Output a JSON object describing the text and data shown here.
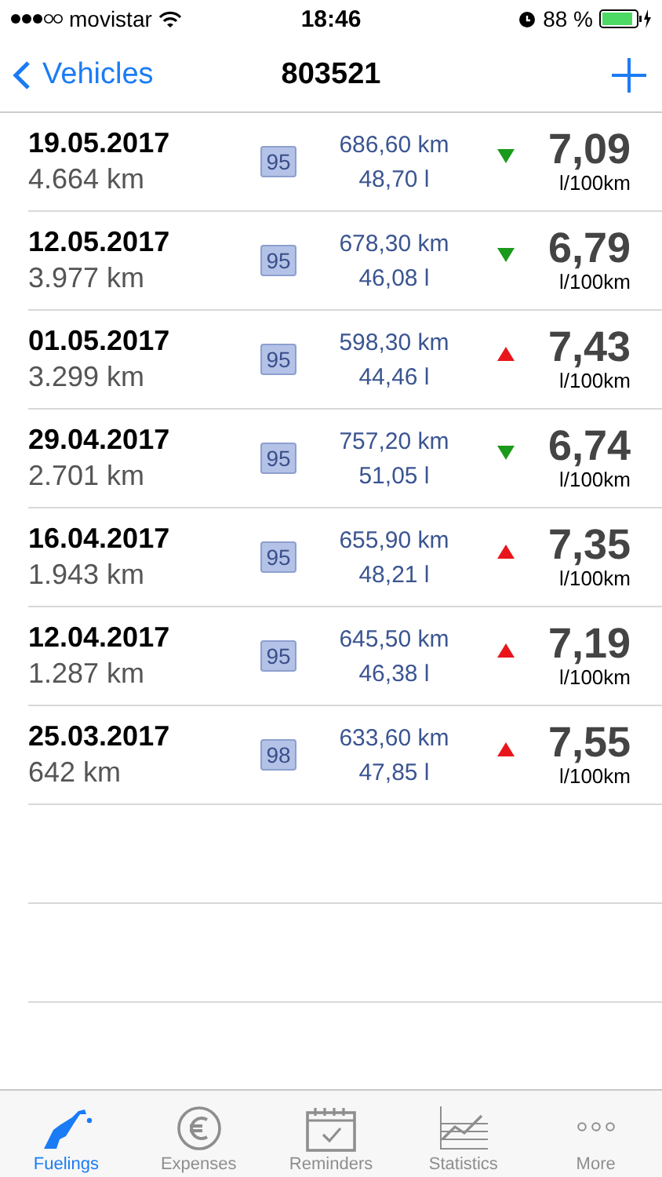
{
  "status_bar": {
    "carrier": "movistar",
    "time": "18:46",
    "battery": "88 %"
  },
  "nav": {
    "back": "Vehicles",
    "title": "803521"
  },
  "fuelings": [
    {
      "date": "19.05.2017",
      "odometer": "4.664 km",
      "fuel": "95",
      "distance": "686,60 km",
      "volume": "48,70 l",
      "improved": true,
      "consumption": "7,09",
      "unit": "l/100km"
    },
    {
      "date": "12.05.2017",
      "odometer": "3.977 km",
      "fuel": "95",
      "distance": "678,30 km",
      "volume": "46,08 l",
      "improved": true,
      "consumption": "6,79",
      "unit": "l/100km"
    },
    {
      "date": "01.05.2017",
      "odometer": "3.299 km",
      "fuel": "95",
      "distance": "598,30 km",
      "volume": "44,46 l",
      "improved": false,
      "consumption": "7,43",
      "unit": "l/100km"
    },
    {
      "date": "29.04.2017",
      "odometer": "2.701 km",
      "fuel": "95",
      "distance": "757,20 km",
      "volume": "51,05 l",
      "improved": true,
      "consumption": "6,74",
      "unit": "l/100km"
    },
    {
      "date": "16.04.2017",
      "odometer": "1.943 km",
      "fuel": "95",
      "distance": "655,90 km",
      "volume": "48,21 l",
      "improved": false,
      "consumption": "7,35",
      "unit": "l/100km"
    },
    {
      "date": "12.04.2017",
      "odometer": "1.287 km",
      "fuel": "95",
      "distance": "645,50 km",
      "volume": "46,38 l",
      "improved": false,
      "consumption": "7,19",
      "unit": "l/100km"
    },
    {
      "date": "25.03.2017",
      "odometer": "642 km",
      "fuel": "98",
      "distance": "633,60 km",
      "volume": "47,85 l",
      "improved": false,
      "consumption": "7,55",
      "unit": "l/100km"
    }
  ],
  "tabs": [
    {
      "label": "Fuelings",
      "kind": "pump",
      "selected": true
    },
    {
      "label": "Expenses",
      "kind": "euro",
      "selected": false
    },
    {
      "label": "Reminders",
      "kind": "calendar",
      "selected": false
    },
    {
      "label": "Statistics",
      "kind": "chart",
      "selected": false
    },
    {
      "label": "More",
      "kind": "more",
      "selected": false
    }
  ]
}
